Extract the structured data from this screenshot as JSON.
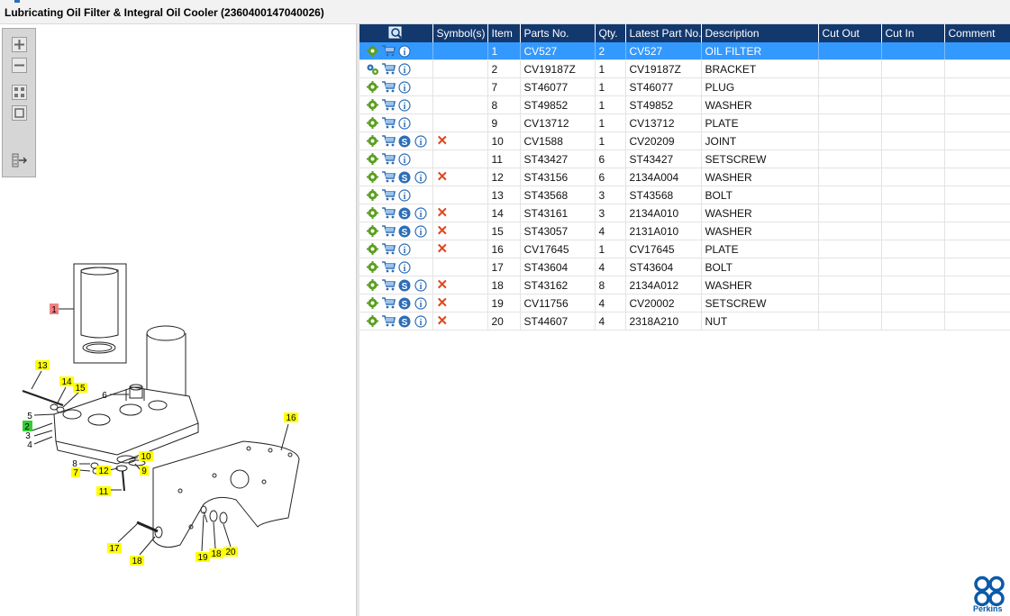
{
  "window": {
    "title": "Lubricating Oil Filter & Integral Oil Cooler (2360400147040026)"
  },
  "toolbar": {
    "buttons": [
      "zoom-in",
      "zoom-out",
      "fit-all",
      "fit-window",
      "export"
    ]
  },
  "grid": {
    "columns": [
      "",
      "Symbol(s)",
      "Item",
      "Parts No.",
      "Qty.",
      "Latest Part No.",
      "Description",
      "Cut Out",
      "Cut In",
      "Comment"
    ],
    "selected_index": 0,
    "rows": [
      {
        "icons": [
          "gear",
          "cart",
          "info"
        ],
        "symbol": false,
        "item": "1",
        "part": "CV527",
        "qty": "2",
        "latest": "CV527",
        "desc": "OIL FILTER"
      },
      {
        "icons": [
          "gears",
          "cart",
          "info"
        ],
        "symbol": false,
        "item": "2",
        "part": "CV19187Z",
        "qty": "1",
        "latest": "CV19187Z",
        "desc": "BRACKET"
      },
      {
        "icons": [
          "gear",
          "cart",
          "info"
        ],
        "symbol": false,
        "item": "7",
        "part": "ST46077",
        "qty": "1",
        "latest": "ST46077",
        "desc": "PLUG"
      },
      {
        "icons": [
          "gear",
          "cart",
          "info"
        ],
        "symbol": false,
        "item": "8",
        "part": "ST49852",
        "qty": "1",
        "latest": "ST49852",
        "desc": "WASHER"
      },
      {
        "icons": [
          "gear",
          "cart",
          "info"
        ],
        "symbol": false,
        "item": "9",
        "part": "CV13712",
        "qty": "1",
        "latest": "CV13712",
        "desc": "PLATE"
      },
      {
        "icons": [
          "gear",
          "cart",
          "s",
          "info"
        ],
        "symbol": true,
        "item": "10",
        "part": "CV1588",
        "qty": "1",
        "latest": "CV20209",
        "desc": "JOINT"
      },
      {
        "icons": [
          "gear",
          "cart",
          "info"
        ],
        "symbol": false,
        "item": "11",
        "part": "ST43427",
        "qty": "6",
        "latest": "ST43427",
        "desc": "SETSCREW"
      },
      {
        "icons": [
          "gear",
          "cart",
          "s",
          "info"
        ],
        "symbol": true,
        "item": "12",
        "part": "ST43156",
        "qty": "6",
        "latest": "2134A004",
        "desc": "WASHER"
      },
      {
        "icons": [
          "gear",
          "cart",
          "info"
        ],
        "symbol": false,
        "item": "13",
        "part": "ST43568",
        "qty": "3",
        "latest": "ST43568",
        "desc": "BOLT"
      },
      {
        "icons": [
          "gear",
          "cart",
          "s",
          "info"
        ],
        "symbol": true,
        "item": "14",
        "part": "ST43161",
        "qty": "3",
        "latest": "2134A010",
        "desc": "WASHER"
      },
      {
        "icons": [
          "gear",
          "cart",
          "s",
          "info"
        ],
        "symbol": true,
        "item": "15",
        "part": "ST43057",
        "qty": "4",
        "latest": "2131A010",
        "desc": "WASHER"
      },
      {
        "icons": [
          "gear",
          "cart",
          "info"
        ],
        "symbol": true,
        "item": "16",
        "part": "CV17645",
        "qty": "1",
        "latest": "CV17645",
        "desc": "PLATE"
      },
      {
        "icons": [
          "gear",
          "cart",
          "info"
        ],
        "symbol": false,
        "item": "17",
        "part": "ST43604",
        "qty": "4",
        "latest": "ST43604",
        "desc": "BOLT"
      },
      {
        "icons": [
          "gear",
          "cart",
          "s",
          "info"
        ],
        "symbol": true,
        "item": "18",
        "part": "ST43162",
        "qty": "8",
        "latest": "2134A012",
        "desc": "WASHER"
      },
      {
        "icons": [
          "gear",
          "cart",
          "s",
          "info"
        ],
        "symbol": true,
        "item": "19",
        "part": "CV11756",
        "qty": "4",
        "latest": "CV20002",
        "desc": "SETSCREW"
      },
      {
        "icons": [
          "gear",
          "cart",
          "s",
          "info"
        ],
        "symbol": true,
        "item": "20",
        "part": "ST44607",
        "qty": "4",
        "latest": "2318A210",
        "desc": "NUT"
      }
    ]
  },
  "diagram": {
    "callouts": [
      "1",
      "2",
      "3",
      "4",
      "5",
      "6",
      "7",
      "8",
      "9",
      "10",
      "11",
      "12",
      "13",
      "14",
      "15",
      "16",
      "17",
      "18",
      "19",
      "20"
    ],
    "highlight_colors": {
      "selected": "#f08080",
      "other": "#ffff00",
      "current": "#33cc33"
    }
  },
  "brand": {
    "name": "Perkins"
  },
  "colors": {
    "header": "#13386e",
    "selection": "#3399ff",
    "gear": "#5a9e1f",
    "cart": "#2d6db5",
    "x": "#e0461b"
  }
}
